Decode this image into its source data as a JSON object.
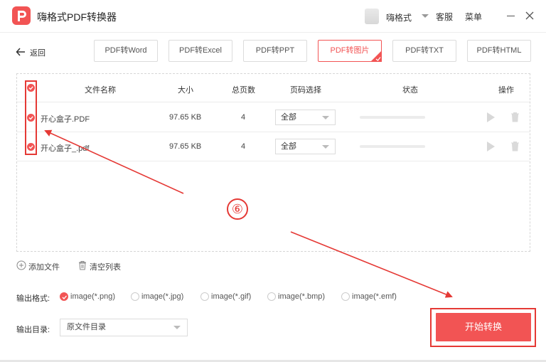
{
  "app": {
    "title": "嗨格式PDF转换器",
    "user_name": "嗨格式",
    "service_label": "客服",
    "menu_label": "菜单",
    "accent_color": "#f25454"
  },
  "nav": {
    "back_label": "返回"
  },
  "tabs": [
    {
      "label": "PDF转Word",
      "active": false
    },
    {
      "label": "PDF转Excel",
      "active": false
    },
    {
      "label": "PDF转PPT",
      "active": false
    },
    {
      "label": "PDF转图片",
      "active": true
    },
    {
      "label": "PDF转TXT",
      "active": false
    },
    {
      "label": "PDF转HTML",
      "active": false
    }
  ],
  "table": {
    "headers": {
      "name": "文件名称",
      "size": "大小",
      "pages": "总页数",
      "page_select": "页码选择",
      "status": "状态",
      "actions": "操作"
    },
    "rows": [
      {
        "name": "开心盒子.PDF",
        "size": "97.65 KB",
        "pages": "4",
        "page_select": "全部"
      },
      {
        "name": "开心盒子_.pdf",
        "size": "97.65 KB",
        "pages": "4",
        "page_select": "全部"
      }
    ]
  },
  "list_actions": {
    "add_file": "添加文件",
    "clear_list": "清空列表"
  },
  "output": {
    "format_label": "输出格式:",
    "formats": [
      {
        "label": "image(*.png)",
        "selected": true
      },
      {
        "label": "image(*.jpg)",
        "selected": false
      },
      {
        "label": "image(*.gif)",
        "selected": false
      },
      {
        "label": "image(*.bmp)",
        "selected": false
      },
      {
        "label": "image(*.emf)",
        "selected": false
      }
    ],
    "dir_label": "输出目录:",
    "dir_value": "原文件目录"
  },
  "start_button": "开始转换",
  "annotation": {
    "step": "⑥",
    "color": "#e53935"
  }
}
